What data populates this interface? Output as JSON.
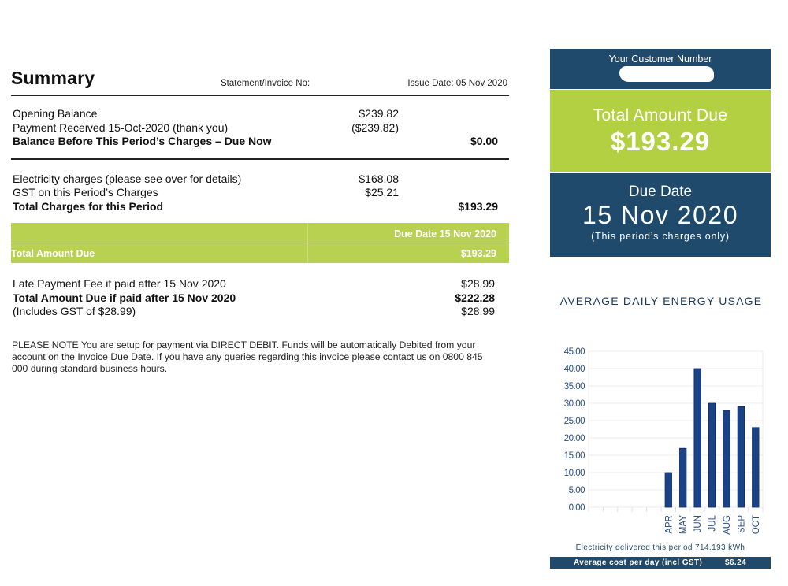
{
  "summary": {
    "title": "Summary",
    "statement_label": "Statement/Invoice No:",
    "issue_date": "Issue Date: 05 Nov 2020",
    "balance_rows": [
      {
        "label": "Opening Balance",
        "mid": "$239.82",
        "amount": ""
      },
      {
        "label": "Payment Received 15-Oct-2020 (thank you)",
        "mid": "($239.82)",
        "amount": ""
      },
      {
        "label": "Balance Before This Period’s Charges – Due Now",
        "mid": "",
        "amount": "$0.00",
        "bold": true
      }
    ],
    "charge_rows": [
      {
        "label": "Electricity charges (please see over for details)",
        "mid": "$168.08",
        "amount": ""
      },
      {
        "label": "GST on this Period’s Charges",
        "mid": "$25.21",
        "amount": ""
      },
      {
        "label": "Total Charges for this Period",
        "mid": "",
        "amount": "$193.29",
        "bold": true
      }
    ],
    "due_band": {
      "due_label": "Due Date 15 Nov 2020",
      "total_label": "Total Amount Due",
      "total_amount": "$193.29"
    },
    "late_rows": [
      {
        "label": "Late Payment Fee if paid after 15 Nov 2020",
        "amount": "$28.99"
      },
      {
        "label": "Total Amount Due if paid after 15 Nov 2020",
        "amount": "$222.28",
        "bold": true
      },
      {
        "label": "(Includes GST of $28.99)",
        "amount": "$28.99"
      }
    ],
    "note": "PLEASE NOTE You are setup for payment via DIRECT DEBIT. Funds will be automatically Debited from your account on the Invoice Due Date. If you have any queries regarding this invoice please contact us on 0800 845 000 during standard business hours."
  },
  "sidebar": {
    "customer_label": "Your Customer Number",
    "customer_number": "",
    "total_label": "Total Amount Due",
    "total_value": "$193.29",
    "due_title": "Due Date",
    "due_date": "15 Nov 2020",
    "due_note": "(This period’s charges only)",
    "colors": {
      "navy": "#1f4a6c",
      "green": "#b3d043",
      "bar": "#1a4386"
    }
  },
  "chart_data": {
    "type": "bar",
    "title": "AVERAGE DAILY ENERGY USAGE",
    "categories": [
      "",
      "",
      "",
      "",
      "",
      "APR",
      "MAY",
      "JUN",
      "JUL",
      "AUG",
      "SEP",
      "OCT"
    ],
    "values": [
      null,
      null,
      null,
      null,
      null,
      10,
      17,
      40,
      30,
      28,
      29,
      23
    ],
    "y_ticks": [
      "0.00",
      "5.00",
      "10.00",
      "15.00",
      "20.00",
      "25.00",
      "30.00",
      "35.00",
      "40.00",
      "45.00"
    ],
    "ylim": [
      0,
      45
    ],
    "xlabel": "",
    "ylabel": "",
    "grid": true,
    "legend": "none"
  },
  "chart_footer": {
    "delivered": "Electricity delivered this period 714.193 kWh",
    "avg_cost_label": "Average cost per day (incl GST)",
    "avg_cost_value": "$6.24"
  }
}
